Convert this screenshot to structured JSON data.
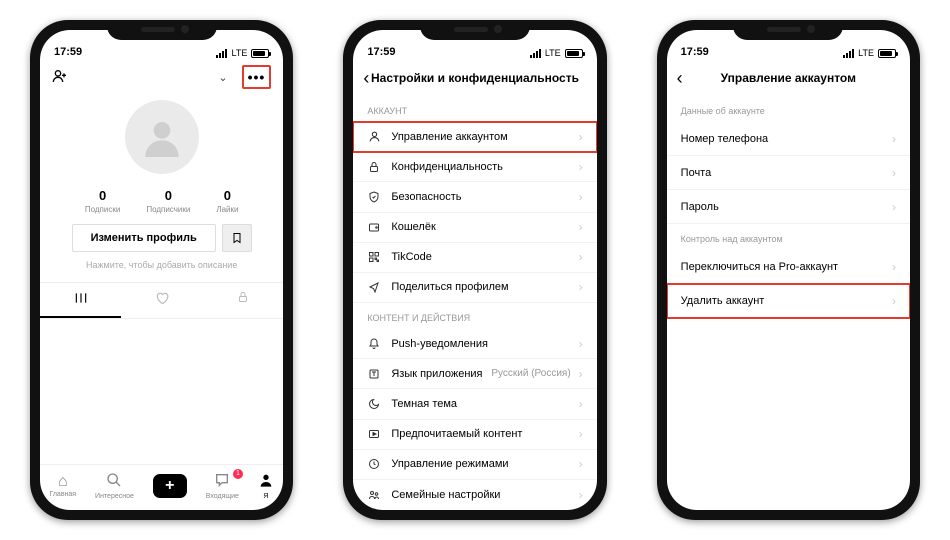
{
  "status": {
    "time": "17:59",
    "network": "LTE"
  },
  "phone1": {
    "username": "",
    "stats": [
      {
        "count": "0",
        "label": "Подписки"
      },
      {
        "count": "0",
        "label": "Подписчики"
      },
      {
        "count": "0",
        "label": "Лайки"
      }
    ],
    "edit_label": "Изменить профиль",
    "bio_hint": "Нажмите, чтобы добавить описание",
    "nav": {
      "home": "Главная",
      "discover": "Интересное",
      "inbox": "Входящие",
      "inbox_badge": "1",
      "me": "Я"
    }
  },
  "phone2": {
    "title": "Настройки и конфиденциальность",
    "section_account": "АККАУНТ",
    "section_content": "КОНТЕНТ И ДЕЙСТВИЯ",
    "items_account": [
      {
        "icon": "person",
        "label": "Управление аккаунтом",
        "hl": true
      },
      {
        "icon": "lock",
        "label": "Конфиденциальность"
      },
      {
        "icon": "shield",
        "label": "Безопасность"
      },
      {
        "icon": "wallet",
        "label": "Кошелёк"
      },
      {
        "icon": "qr",
        "label": "TikCode"
      },
      {
        "icon": "share",
        "label": "Поделиться профилем"
      }
    ],
    "items_content": [
      {
        "icon": "bell",
        "label": "Push-уведомления"
      },
      {
        "icon": "lang",
        "label": "Язык приложения",
        "value": "Русский (Россия)"
      },
      {
        "icon": "moon",
        "label": "Темная тема"
      },
      {
        "icon": "play",
        "label": "Предпочитаемый контент"
      },
      {
        "icon": "clock",
        "label": "Управление режимами"
      },
      {
        "icon": "family",
        "label": "Семейные настройки"
      }
    ]
  },
  "phone3": {
    "title": "Управление аккаунтом",
    "section_data": "Данные об аккаунте",
    "section_control": "Контроль над аккаунтом",
    "items_data": [
      {
        "label": "Номер телефона"
      },
      {
        "label": "Почта"
      },
      {
        "label": "Пароль"
      }
    ],
    "items_control": [
      {
        "label": "Переключиться на Pro-аккаунт"
      },
      {
        "label": "Удалить аккаунт",
        "hl": true
      }
    ]
  }
}
